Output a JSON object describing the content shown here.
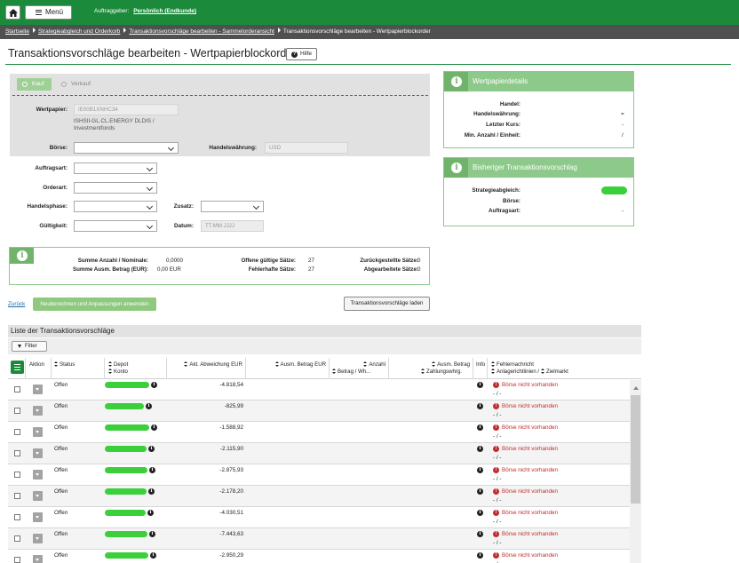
{
  "header": {
    "menu_label": "Menü",
    "client_label": "Auftraggeber:",
    "client_value": "Persönlich (Endkunde)"
  },
  "breadcrumb": [
    "Startseite",
    "Strategieabgleich und Orderkorb",
    "Transaktionsvorschläge bearbeiten - Sammelorderansicht",
    "Transaktionsvorschläge bearbeiten - Wertpapierblockorder"
  ],
  "page": {
    "title": "Transaktionsvorschläge bearbeiten - Wertpapierblockorder",
    "help_label": "Hilfe"
  },
  "order_form": {
    "tab_buy": "Kauf",
    "tab_sell": "Verkauf",
    "security_label": "Wertpapier:",
    "security_isin": "IE00B1XNHC34",
    "security_name": "ISHSII-GL.CL.ENERGY DLDIS / Investmentfonds",
    "exchange_label": "Börse:",
    "trading_currency_label": "Handelswährung:",
    "trading_currency_value": "USD",
    "order_type_label": "Auftragsart:",
    "order_kind_label": "Orderart:",
    "trading_phase_label": "Handelsphase:",
    "addition_label": "Zusatz:",
    "validity_label": "Gültigkeit:",
    "date_label": "Datum:",
    "date_placeholder": "TT.MM.JJJJ"
  },
  "security_details": {
    "title": "Wertpapierdetails",
    "rows": [
      {
        "label": "Handel:",
        "value": ""
      },
      {
        "label": "Handelswährung:",
        "value": "="
      },
      {
        "label": "Letzter Kurs:",
        "value": "-"
      },
      {
        "label": "Min. Anzahl / Einheit:",
        "value": "/"
      }
    ]
  },
  "previous_proposal": {
    "title": "Bisheriger Transaktionsvorschlag",
    "rows": [
      {
        "label": "Strategieabgleich:",
        "value": ""
      },
      {
        "label": "Börse:",
        "value": ""
      },
      {
        "label": "Auftragsart:",
        "value": "-"
      }
    ]
  },
  "summary": {
    "sum_count_label": "Summe Anzahl / Nominale:",
    "sum_count_value": "0,0000",
    "sum_amount_label": "Summe Ausm. Betrag (EUR):",
    "sum_amount_value": "0,00 EUR",
    "open_valid_label": "Offene gültige Sätze:",
    "open_valid_value": "27",
    "faulty_label": "Fehlerhafte Sätze:",
    "faulty_value": "27",
    "rejected_label": "Zurückgestellte Sätze:",
    "rejected_value": "0",
    "processed_label": "Abgearbeitete Sätze:",
    "processed_value": "0"
  },
  "actions": {
    "back": "Zurück",
    "recalculate": "Neuberechnen und Anpassungen anwenden",
    "load": "Transaktionsvorschläge laden"
  },
  "list": {
    "title": "Liste der Transaktionsvorschläge",
    "filter_label": "Filter",
    "columns": {
      "aktion": "Aktion",
      "status": "Status",
      "depot": "Depot",
      "konto": "Konto",
      "abweichung": "Akt. Abweichung EUR",
      "ausm_betrag": "Ausm. Betrag EUR",
      "anzahl": "Anzahl",
      "betrag_wh": "Betrag / Wh...",
      "ausm_betrag2": "Ausm. Betrag",
      "zahlungswhrg": "Zahlungswhrg.",
      "info": "Info",
      "fehler": "Fehlernachricht",
      "anlage": "Anlagerichtlinien /",
      "zielmarkt": "Zielmarkt"
    },
    "rows": [
      {
        "status": "Offen",
        "deviation": "-4.818,54",
        "error": "Börse nicht vorhanden",
        "sub": "- / -"
      },
      {
        "status": "Offen",
        "deviation": "-825,99",
        "error": "Börse nicht vorhanden",
        "sub": "- / -"
      },
      {
        "status": "Offen",
        "deviation": "-1.588,92",
        "error": "Börse nicht vorhanden",
        "sub": "- / -"
      },
      {
        "status": "Offen",
        "deviation": "-2.115,90",
        "error": "Börse nicht vorhanden",
        "sub": "- / -"
      },
      {
        "status": "Offen",
        "deviation": "-2.875,93",
        "error": "Börse nicht vorhanden",
        "sub": "- / -"
      },
      {
        "status": "Offen",
        "deviation": "-2.178,20",
        "error": "Börse nicht vorhanden",
        "sub": "- / -"
      },
      {
        "status": "Offen",
        "deviation": "-4.030,51",
        "error": "Börse nicht vorhanden",
        "sub": "- / -"
      },
      {
        "status": "Offen",
        "deviation": "-7.443,63",
        "error": "Börse nicht vorhanden",
        "sub": "- / -"
      },
      {
        "status": "Offen",
        "deviation": "-2.950,29",
        "error": "Börse nicht vorhanden",
        "sub": "- / -"
      }
    ]
  },
  "colors": {
    "brand_green": "#1b8a3b",
    "light_green": "#8dc98a",
    "redaction_green": "#3ccf3c",
    "error_red": "#c42a2a"
  }
}
